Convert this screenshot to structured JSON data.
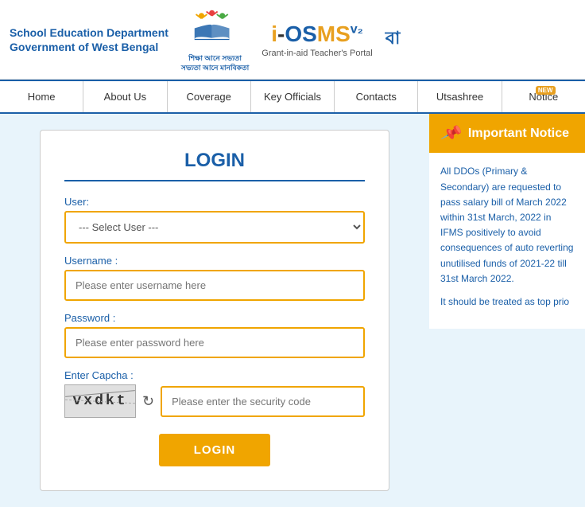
{
  "header": {
    "dept_line1": "School Education Department",
    "dept_line2": "Government of West Bengal",
    "logo_text1": "শিক্ষা আনে সভ্যতা",
    "logo_text2": "সভ্যতা আনে মানবিকতা",
    "portal_subtitle": "Grant-in-aid Teacher's Portal",
    "lang_label": "বা"
  },
  "nav": {
    "items": [
      {
        "label": "Home",
        "id": "home",
        "badge": ""
      },
      {
        "label": "About Us",
        "id": "about-us",
        "badge": ""
      },
      {
        "label": "Coverage",
        "id": "coverage",
        "badge": ""
      },
      {
        "label": "Key Officials",
        "id": "key-officials",
        "badge": ""
      },
      {
        "label": "Contacts",
        "id": "contacts",
        "badge": ""
      },
      {
        "label": "Utsashree",
        "id": "utsashree",
        "badge": ""
      },
      {
        "label": "Notice",
        "id": "notice",
        "badge": "NEW"
      }
    ]
  },
  "login": {
    "title": "LOGIN",
    "user_label": "User:",
    "user_default": "--- Select User ---",
    "username_label": "Username :",
    "username_placeholder": "Please enter username here",
    "password_label": "Password :",
    "password_placeholder": "Please enter password here",
    "capcha_label": "Enter Capcha :",
    "captcha_text": "vxdkt",
    "captcha_placeholder": "Please enter the security code",
    "login_btn": "LOGIN"
  },
  "notice": {
    "header": "Important Notice",
    "body1": "All DDOs (Primary & Secondary) are requested to pass salary bill of March 2022 within 31st March, 2022 in IFMS positively to avoid consequences of auto reverting unutilised funds of 2021-22 till 31st March 2022.",
    "body2": "It should be treated as top prio"
  }
}
